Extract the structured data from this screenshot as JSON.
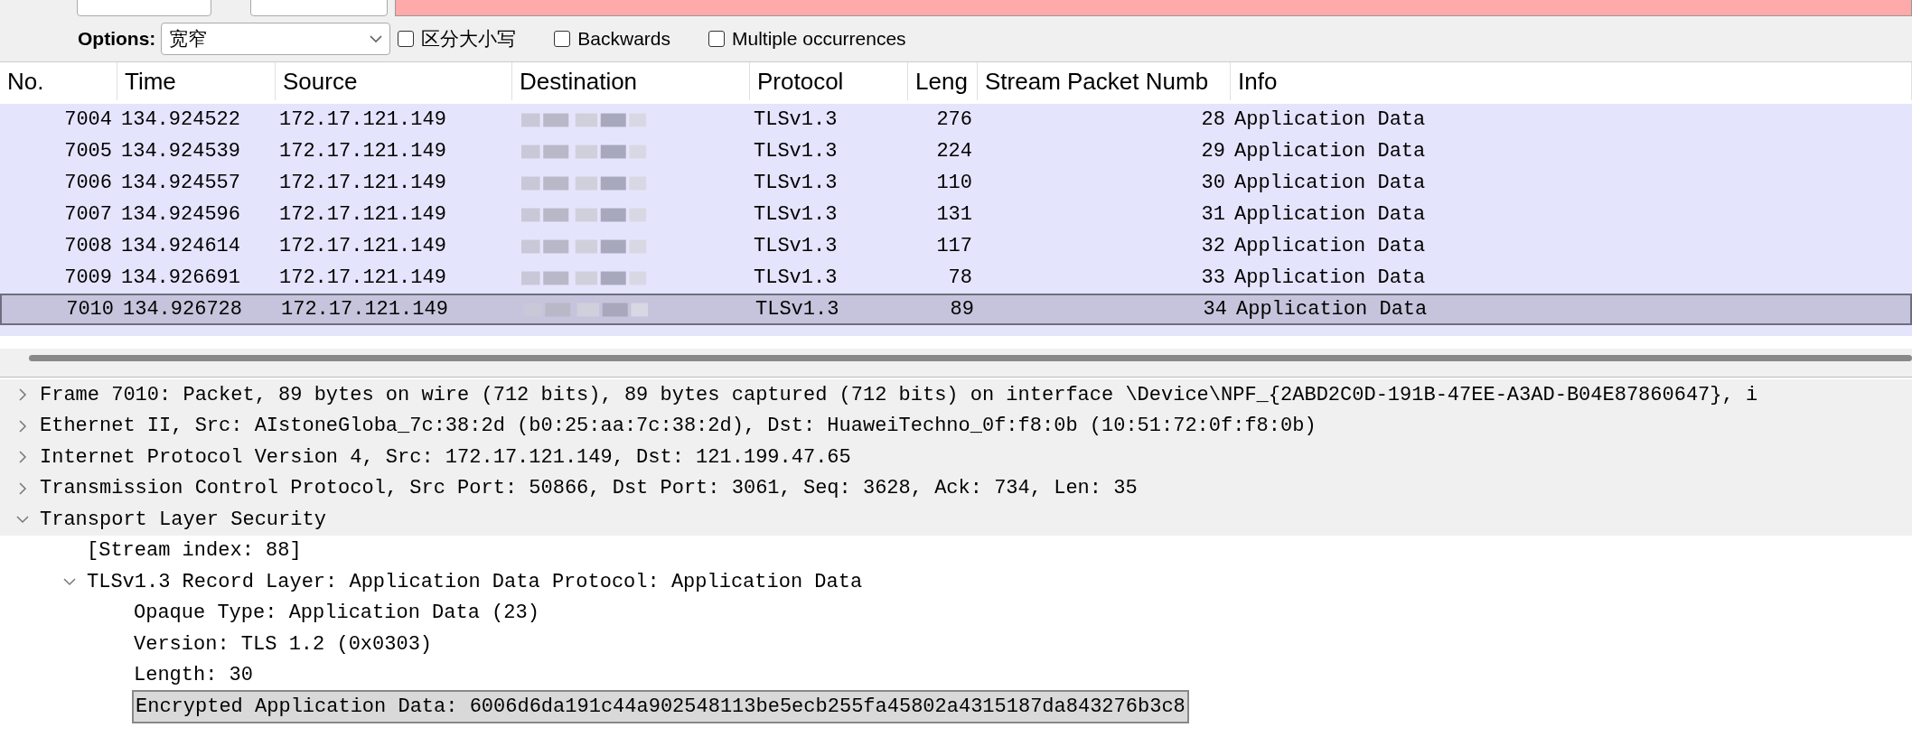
{
  "find_bar": {
    "search_field": {
      "invalid": true
    },
    "options_label": "Options:",
    "mode_select": {
      "value": "宽窄"
    },
    "checkboxes": [
      {
        "label": "区分大小写",
        "checked": false
      },
      {
        "label": "Backwards",
        "checked": false
      },
      {
        "label": "Multiple occurrences",
        "checked": false
      }
    ]
  },
  "packet_list": {
    "columns": [
      "No.",
      "Time",
      "Source",
      "Destination",
      "Protocol",
      "Leng",
      "Stream Packet Numb",
      "Info"
    ],
    "rows": [
      {
        "no": "7004",
        "time": "134.924522",
        "source": "172.17.121.149",
        "protocol": "TLSv1.3",
        "length": "276",
        "stream_packet": "28",
        "info": "Application Data",
        "selected": false
      },
      {
        "no": "7005",
        "time": "134.924539",
        "source": "172.17.121.149",
        "protocol": "TLSv1.3",
        "length": "224",
        "stream_packet": "29",
        "info": "Application Data",
        "selected": false
      },
      {
        "no": "7006",
        "time": "134.924557",
        "source": "172.17.121.149",
        "protocol": "TLSv1.3",
        "length": "110",
        "stream_packet": "30",
        "info": "Application Data",
        "selected": false
      },
      {
        "no": "7007",
        "time": "134.924596",
        "source": "172.17.121.149",
        "protocol": "TLSv1.3",
        "length": "131",
        "stream_packet": "31",
        "info": "Application Data",
        "selected": false
      },
      {
        "no": "7008",
        "time": "134.924614",
        "source": "172.17.121.149",
        "protocol": "TLSv1.3",
        "length": "117",
        "stream_packet": "32",
        "info": "Application Data",
        "selected": false
      },
      {
        "no": "7009",
        "time": "134.926691",
        "source": "172.17.121.149",
        "protocol": "TLSv1.3",
        "length": "78",
        "stream_packet": "33",
        "info": "Application Data",
        "selected": false
      },
      {
        "no": "7010",
        "time": "134.926728",
        "source": "172.17.121.149",
        "protocol": "TLSv1.3",
        "length": "89",
        "stream_packet": "34",
        "info": "Application Data",
        "selected": true
      }
    ]
  },
  "details": [
    {
      "text": "Frame 7010: Packet, 89 bytes on wire (712 bits), 89 bytes captured (712 bits) on interface \\Device\\NPF_{2ABD2C0D-191B-47EE-A3AD-B04E87860647}, i",
      "expanded": false,
      "selected": false
    },
    {
      "text": "Ethernet II, Src: AIstoneGloba_7c:38:2d (b0:25:aa:7c:38:2d), Dst: HuaweiTechno_0f:f8:0b (10:51:72:0f:f8:0b)",
      "expanded": false,
      "selected": false
    },
    {
      "text": "Internet Protocol Version 4, Src: 172.17.121.149, Dst: 121.199.47.65",
      "expanded": false,
      "selected": false
    },
    {
      "text": "Transmission Control Protocol, Src Port: 50866, Dst Port: 3061, Seq: 3628, Ack: 734, Len: 35",
      "expanded": false,
      "selected": false
    },
    {
      "text": "Transport Layer Security",
      "expanded": true,
      "selected": false,
      "children": [
        {
          "text": "[Stream index: 88]",
          "selected": false
        },
        {
          "text": "TLSv1.3 Record Layer: Application Data Protocol: Application Data",
          "expanded": true,
          "selected": false,
          "children": [
            {
              "text": "Opaque Type: Application Data (23)",
              "selected": false
            },
            {
              "text": "Version: TLS 1.2 (0x0303)",
              "selected": false
            },
            {
              "text": "Length: 30",
              "selected": false
            },
            {
              "text": "Encrypted Application Data: 6006d6da191c44a902548113be5ecb255fa45802a4315187da843276b3c8",
              "selected": true
            }
          ]
        }
      ]
    }
  ]
}
